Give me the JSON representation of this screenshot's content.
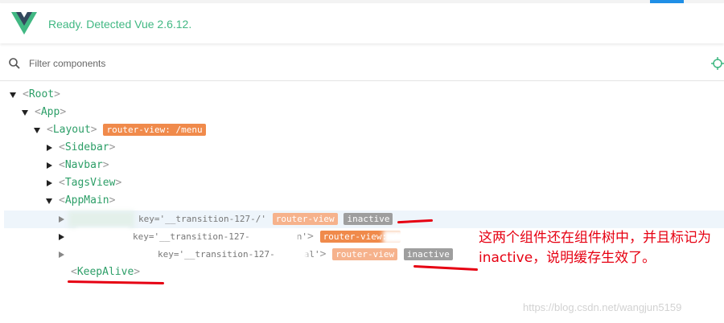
{
  "devtools": {
    "status": "Ready. Detected Vue 2.6.12.",
    "filter_placeholder": "Filter components",
    "colors": {
      "vue_green": "#41b883",
      "accent": "#1f8fe6",
      "badge_orange": "#f08a4b",
      "badge_gray": "#9e9e9e"
    }
  },
  "tree": {
    "root": "Root",
    "app": "App",
    "layout": "Layout",
    "layout_badge": "router-view: /menu",
    "sidebar": "Sidebar",
    "navbar": "Navbar",
    "tagsview": "TagsView",
    "appmain": "AppMain",
    "child1_key": "key='__transition-127-/'",
    "child1_badge": "router-view",
    "child1_state": "inactive",
    "child2_key": "key='__transition-127-",
    "child2_key_end": "n'",
    "child2_badge": "router-view: /",
    "child3_key": "key='__transition-127-",
    "child3_key_end": "al'",
    "child3_badge": "router-view",
    "child3_state": "inactive",
    "keepalive": "KeepAlive",
    "bracket_open": "<",
    "bracket_close": ">"
  },
  "annotation": {
    "text": "这两个组件还在组件树中，并且标记为inactive，说明缓存生效了。",
    "color": "#e60012"
  },
  "watermark": "https://blog.csdn.net/wangjun5159"
}
